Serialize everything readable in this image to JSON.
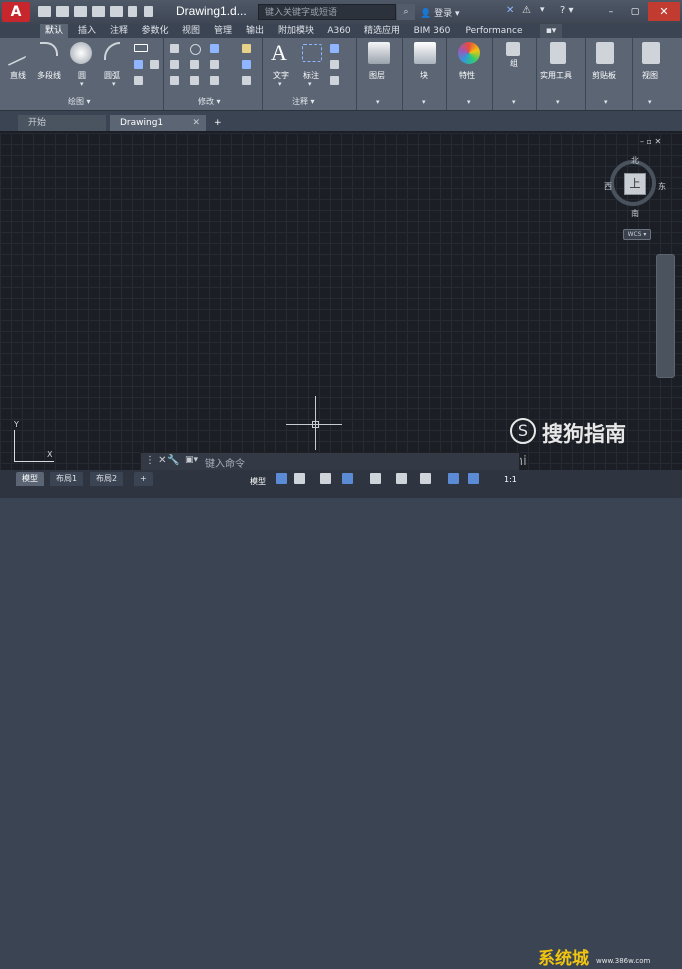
{
  "app": {
    "logo_letter": "A",
    "doc_title": "Drawing1.d...",
    "search_placeholder": "键入关键字或短语",
    "login": "登录"
  },
  "window": {
    "min": "–",
    "max": "▢",
    "close": "✕"
  },
  "ribbon_tabs": [
    "默认",
    "插入",
    "注释",
    "参数化",
    "视图",
    "管理",
    "输出",
    "附加模块",
    "A360",
    "精选应用",
    "BIM 360",
    "Performance"
  ],
  "ribbon": {
    "draw": {
      "line": "直线",
      "polyline": "多段线",
      "circle": "圆",
      "arc": "圆弧",
      "title": "绘图"
    },
    "modify": {
      "title": "修改"
    },
    "annotation": {
      "text": "文字",
      "dimension": "标注",
      "title": "注释"
    },
    "layers": "图层",
    "block": "块",
    "properties": "特性",
    "groups": "组",
    "utilities": "实用工具",
    "clipboard": "剪贴板",
    "view": "视图"
  },
  "doc_tabs": {
    "start": "开始",
    "drawing": "Drawing1",
    "add": "+"
  },
  "viewcube": {
    "face": "上",
    "north": "北",
    "south": "南",
    "east": "东",
    "west": "西",
    "wcs": "WCS ▾"
  },
  "canvas_controls": "– ▫ ✕",
  "ucs": {
    "x": "X",
    "y": "Y"
  },
  "watermark": {
    "symbol": "S",
    "text": "搜狗指南",
    "small": "zhi"
  },
  "command": {
    "prompt": "键入命令"
  },
  "layout_tabs": {
    "model": "模型",
    "layout1": "布局1",
    "layout2": "布局2",
    "add": "+"
  },
  "status": {
    "model": "模型",
    "scale": "1:1"
  },
  "site": {
    "logo": "系统城",
    "url": "www.386w.com"
  },
  "colors": {
    "accent": "#c7262c",
    "canvas": "#1b1f25",
    "ribbon": "#5b6574"
  }
}
